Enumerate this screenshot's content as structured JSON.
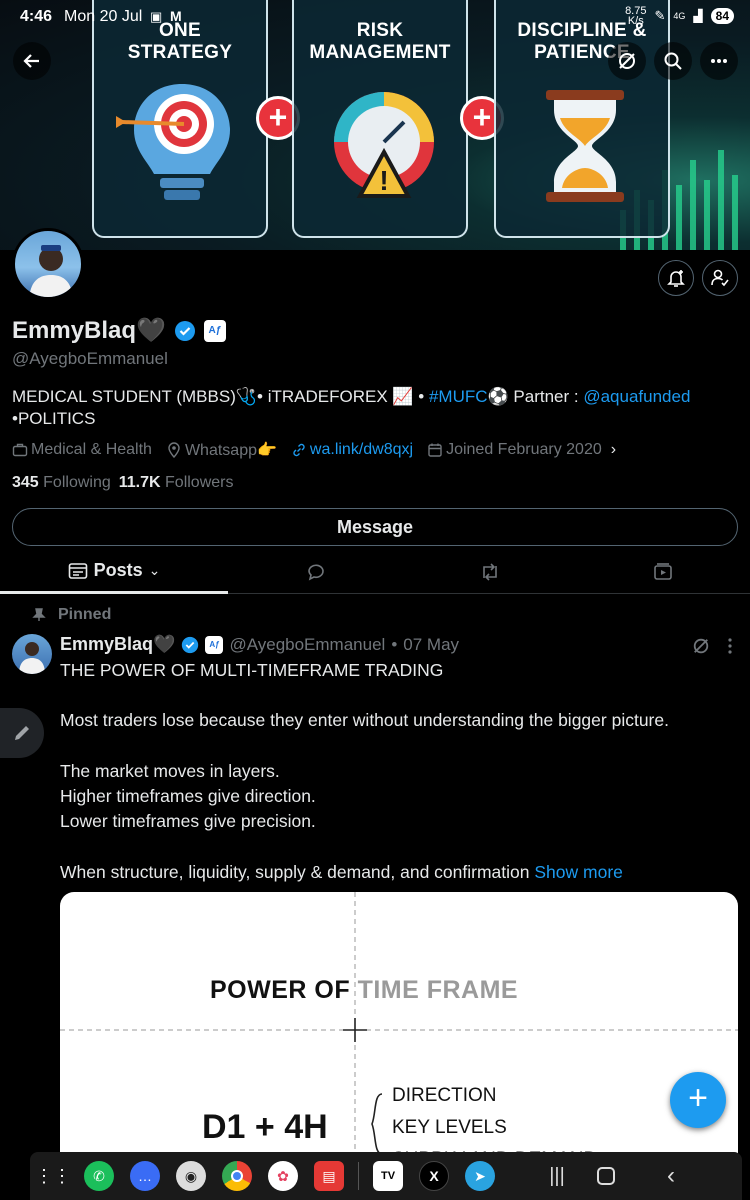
{
  "status_bar": {
    "time": "4:46",
    "date": "Mon 20 Jul",
    "speed": "8.75",
    "speed_unit": "K/s",
    "signal": "4G",
    "battery": "84"
  },
  "banner": {
    "cards": [
      {
        "title": "ONE\nSTRATEGY"
      },
      {
        "title": "RISK\nMANAGEMENT"
      },
      {
        "title": "DISCIPLINE &\nPATIENCE"
      }
    ],
    "plus": "+"
  },
  "profile": {
    "name": "EmmyBlaq🖤",
    "badge_af": "Aƒ",
    "handle": "@AyegboEmmanuel",
    "bio_part1": "MEDICAL STUDENT (MBBS)🩺• iTRADEFOREX 📈 • ",
    "bio_hashtag": "#MUFC",
    "bio_part2": "⚽ Partner : ",
    "bio_mention": "@aquafunded",
    "bio_part3": "•POLITICS",
    "category": "Medical & Health",
    "location": "Whatsapp👉",
    "website": "wa.link/dw8qxj",
    "joined": "Joined February 2020",
    "following_count": "345",
    "following_label": "Following",
    "followers_count": "11.7K",
    "followers_label": "Followers",
    "message_button": "Message"
  },
  "tabs": {
    "posts": "Posts"
  },
  "post": {
    "pinned_label": "Pinned",
    "author_name": "EmmyBlaq🖤",
    "author_handle": "@AyegboEmmanuel",
    "dot": "•",
    "date": "07 May",
    "lines": [
      "THE POWER OF MULTI-TIMEFRAME TRADING",
      "Most traders lose because they enter without understanding the bigger picture.",
      "The market moves in layers.",
      "Higher timeframes give direction.",
      "Lower timeframes give precision.",
      "When structure, liquidity, supply & demand, and confirmation"
    ],
    "show_more": "Show more",
    "image": {
      "title_a": "POWER OF ",
      "title_b": "TIME FRAME",
      "big": "D1 + 4H",
      "list": [
        "DIRECTION",
        "KEY LEVELS",
        "SUPPLY AND DEMAND"
      ]
    }
  },
  "fab": "+",
  "colors": {
    "accent": "#1d9bf0",
    "background": "#000000",
    "muted": "#71767b"
  }
}
